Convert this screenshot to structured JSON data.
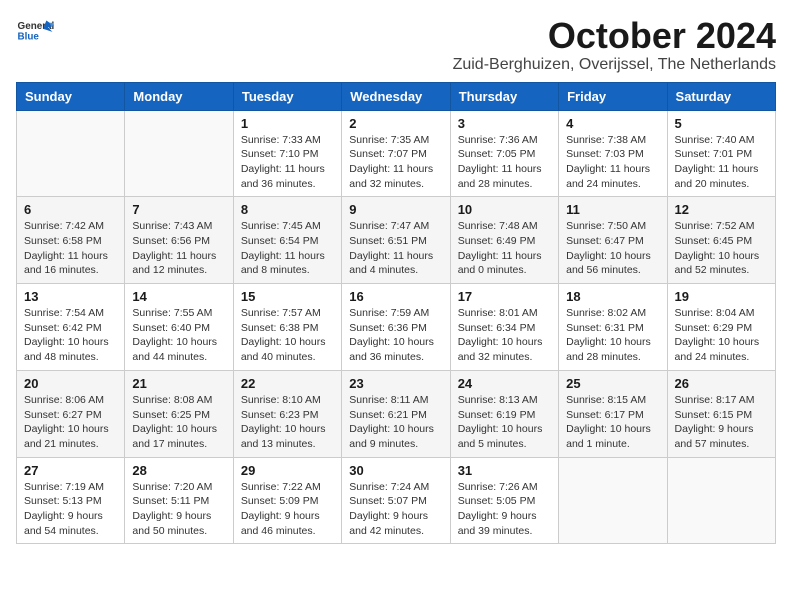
{
  "header": {
    "logo_general": "General",
    "logo_blue": "Blue",
    "month_title": "October 2024",
    "subtitle": "Zuid-Berghuizen, Overijssel, The Netherlands"
  },
  "calendar": {
    "days_of_week": [
      "Sunday",
      "Monday",
      "Tuesday",
      "Wednesday",
      "Thursday",
      "Friday",
      "Saturday"
    ],
    "weeks": [
      [
        {
          "day": "",
          "info": ""
        },
        {
          "day": "",
          "info": ""
        },
        {
          "day": "1",
          "info": "Sunrise: 7:33 AM\nSunset: 7:10 PM\nDaylight: 11 hours and 36 minutes."
        },
        {
          "day": "2",
          "info": "Sunrise: 7:35 AM\nSunset: 7:07 PM\nDaylight: 11 hours and 32 minutes."
        },
        {
          "day": "3",
          "info": "Sunrise: 7:36 AM\nSunset: 7:05 PM\nDaylight: 11 hours and 28 minutes."
        },
        {
          "day": "4",
          "info": "Sunrise: 7:38 AM\nSunset: 7:03 PM\nDaylight: 11 hours and 24 minutes."
        },
        {
          "day": "5",
          "info": "Sunrise: 7:40 AM\nSunset: 7:01 PM\nDaylight: 11 hours and 20 minutes."
        }
      ],
      [
        {
          "day": "6",
          "info": "Sunrise: 7:42 AM\nSunset: 6:58 PM\nDaylight: 11 hours and 16 minutes."
        },
        {
          "day": "7",
          "info": "Sunrise: 7:43 AM\nSunset: 6:56 PM\nDaylight: 11 hours and 12 minutes."
        },
        {
          "day": "8",
          "info": "Sunrise: 7:45 AM\nSunset: 6:54 PM\nDaylight: 11 hours and 8 minutes."
        },
        {
          "day": "9",
          "info": "Sunrise: 7:47 AM\nSunset: 6:51 PM\nDaylight: 11 hours and 4 minutes."
        },
        {
          "day": "10",
          "info": "Sunrise: 7:48 AM\nSunset: 6:49 PM\nDaylight: 11 hours and 0 minutes."
        },
        {
          "day": "11",
          "info": "Sunrise: 7:50 AM\nSunset: 6:47 PM\nDaylight: 10 hours and 56 minutes."
        },
        {
          "day": "12",
          "info": "Sunrise: 7:52 AM\nSunset: 6:45 PM\nDaylight: 10 hours and 52 minutes."
        }
      ],
      [
        {
          "day": "13",
          "info": "Sunrise: 7:54 AM\nSunset: 6:42 PM\nDaylight: 10 hours and 48 minutes."
        },
        {
          "day": "14",
          "info": "Sunrise: 7:55 AM\nSunset: 6:40 PM\nDaylight: 10 hours and 44 minutes."
        },
        {
          "day": "15",
          "info": "Sunrise: 7:57 AM\nSunset: 6:38 PM\nDaylight: 10 hours and 40 minutes."
        },
        {
          "day": "16",
          "info": "Sunrise: 7:59 AM\nSunset: 6:36 PM\nDaylight: 10 hours and 36 minutes."
        },
        {
          "day": "17",
          "info": "Sunrise: 8:01 AM\nSunset: 6:34 PM\nDaylight: 10 hours and 32 minutes."
        },
        {
          "day": "18",
          "info": "Sunrise: 8:02 AM\nSunset: 6:31 PM\nDaylight: 10 hours and 28 minutes."
        },
        {
          "day": "19",
          "info": "Sunrise: 8:04 AM\nSunset: 6:29 PM\nDaylight: 10 hours and 24 minutes."
        }
      ],
      [
        {
          "day": "20",
          "info": "Sunrise: 8:06 AM\nSunset: 6:27 PM\nDaylight: 10 hours and 21 minutes."
        },
        {
          "day": "21",
          "info": "Sunrise: 8:08 AM\nSunset: 6:25 PM\nDaylight: 10 hours and 17 minutes."
        },
        {
          "day": "22",
          "info": "Sunrise: 8:10 AM\nSunset: 6:23 PM\nDaylight: 10 hours and 13 minutes."
        },
        {
          "day": "23",
          "info": "Sunrise: 8:11 AM\nSunset: 6:21 PM\nDaylight: 10 hours and 9 minutes."
        },
        {
          "day": "24",
          "info": "Sunrise: 8:13 AM\nSunset: 6:19 PM\nDaylight: 10 hours and 5 minutes."
        },
        {
          "day": "25",
          "info": "Sunrise: 8:15 AM\nSunset: 6:17 PM\nDaylight: 10 hours and 1 minute."
        },
        {
          "day": "26",
          "info": "Sunrise: 8:17 AM\nSunset: 6:15 PM\nDaylight: 9 hours and 57 minutes."
        }
      ],
      [
        {
          "day": "27",
          "info": "Sunrise: 7:19 AM\nSunset: 5:13 PM\nDaylight: 9 hours and 54 minutes."
        },
        {
          "day": "28",
          "info": "Sunrise: 7:20 AM\nSunset: 5:11 PM\nDaylight: 9 hours and 50 minutes."
        },
        {
          "day": "29",
          "info": "Sunrise: 7:22 AM\nSunset: 5:09 PM\nDaylight: 9 hours and 46 minutes."
        },
        {
          "day": "30",
          "info": "Sunrise: 7:24 AM\nSunset: 5:07 PM\nDaylight: 9 hours and 42 minutes."
        },
        {
          "day": "31",
          "info": "Sunrise: 7:26 AM\nSunset: 5:05 PM\nDaylight: 9 hours and 39 minutes."
        },
        {
          "day": "",
          "info": ""
        },
        {
          "day": "",
          "info": ""
        }
      ]
    ]
  }
}
